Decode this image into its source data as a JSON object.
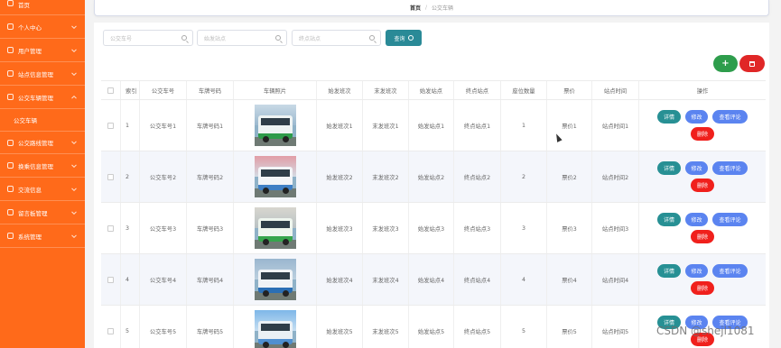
{
  "sidebar": {
    "items": [
      {
        "label": "首页",
        "icon": "home-icon"
      },
      {
        "label": "个人中心",
        "icon": "user-icon"
      },
      {
        "label": "用户管理",
        "icon": "users-icon"
      },
      {
        "label": "站点信息管理",
        "icon": "station-icon"
      },
      {
        "label": "公交车辆管理",
        "icon": "bus-icon",
        "expanded": true
      },
      {
        "label": "公交车辆",
        "sub": true
      },
      {
        "label": "公交路线管理",
        "icon": "route-icon"
      },
      {
        "label": "换乘信息管理",
        "icon": "transfer-icon"
      },
      {
        "label": "交流信息",
        "icon": "chat-icon"
      },
      {
        "label": "留言板管理",
        "icon": "message-board-icon"
      },
      {
        "label": "系统管理",
        "icon": "settings-icon"
      }
    ]
  },
  "breadcrumb": {
    "home": "首页",
    "separator": "/",
    "current": "公交车辆"
  },
  "search": {
    "bus_no_placeholder": "公交车号",
    "start_placeholder": "始发站点",
    "end_placeholder": "终点站点",
    "query_label": "查询"
  },
  "toolbar": {
    "add_label": "+"
  },
  "table": {
    "headers": [
      "索引",
      "公交车号",
      "车牌号码",
      "车辆照片",
      "始发班次",
      "末发班次",
      "始发站点",
      "终点站点",
      "座位数量",
      "票价",
      "站点时间",
      "操作"
    ],
    "rows": [
      {
        "index": "1",
        "bus_no": "公交车号1",
        "plate": "车牌号码1",
        "first": "始发班次1",
        "last": "末发班次1",
        "start": "始发站点1",
        "end": "终点站点1",
        "seats": "1",
        "price": "票价1",
        "time": "站点时间1"
      },
      {
        "index": "2",
        "bus_no": "公交车号2",
        "plate": "车牌号码2",
        "first": "始发班次2",
        "last": "末发班次2",
        "start": "始发站点2",
        "end": "终点站点2",
        "seats": "2",
        "price": "票价2",
        "time": "站点时间2"
      },
      {
        "index": "3",
        "bus_no": "公交车号3",
        "plate": "车牌号码3",
        "first": "始发班次3",
        "last": "末发班次3",
        "start": "始发站点3",
        "end": "终点站点3",
        "seats": "3",
        "price": "票价3",
        "time": "站点时间3"
      },
      {
        "index": "4",
        "bus_no": "公交车号4",
        "plate": "车牌号码4",
        "first": "始发班次4",
        "last": "末发班次4",
        "start": "始发站点4",
        "end": "终点站点4",
        "seats": "4",
        "price": "票价4",
        "time": "站点时间4"
      },
      {
        "index": "5",
        "bus_no": "公交车号5",
        "plate": "车牌号码5",
        "first": "始发班次5",
        "last": "末发班次5",
        "start": "始发站点5",
        "end": "终点站点5",
        "seats": "5",
        "price": "票价5",
        "time": "站点时间5"
      }
    ]
  },
  "actions": {
    "detail": "详情",
    "edit": "修改",
    "review": "查看评论",
    "delete": "删除"
  },
  "watermark": "CSDN @shejl1081",
  "colors": {
    "sidebar": "#ff6a1a",
    "query": "#2a8a97",
    "add": "#2e9d4c",
    "delete": "#e02727",
    "detail": "#279094",
    "edit": "#5b84f0"
  }
}
